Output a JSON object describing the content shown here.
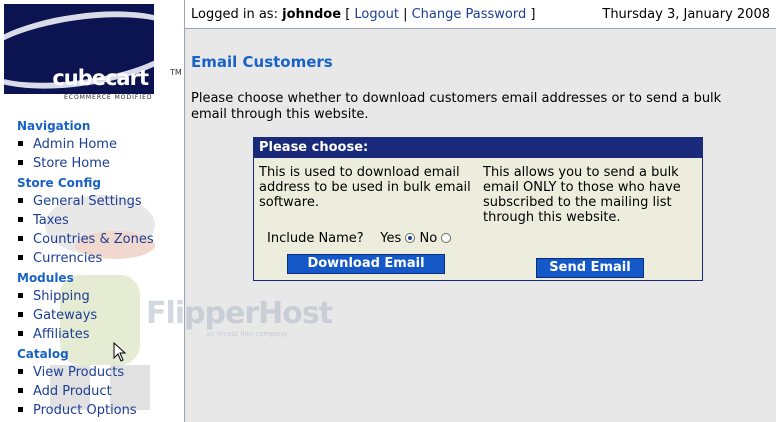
{
  "logo": {
    "wordmark": "cubecart",
    "tm": "TM",
    "subtitle": "ECOMMERCE MODIFIED"
  },
  "header": {
    "logged_in_prefix": "Logged in as:",
    "username": "johndoe",
    "open_bracket": "[",
    "logout": "Logout",
    "separator": "|",
    "change_password": "Change Password",
    "close_bracket": "]",
    "date": "Thursday 3, January 2008"
  },
  "sidebar": {
    "sections": [
      {
        "heading": "Navigation",
        "items": [
          "Admin Home",
          "Store Home"
        ]
      },
      {
        "heading": "Store Config",
        "items": [
          "General Settings",
          "Taxes",
          "Countries & Zones",
          "Currencies"
        ]
      },
      {
        "heading": "Modules",
        "items": [
          "Shipping",
          "Gateways",
          "Affiliates"
        ]
      },
      {
        "heading": "Catalog",
        "items": [
          "View Products",
          "Add Product",
          "Product Options"
        ]
      }
    ]
  },
  "main": {
    "title": "Email Customers",
    "intro": "Please choose whether to download customers email addresses or to send a bulk email through this website.",
    "box": {
      "heading": "Please choose:",
      "download_text": "This is used to download email address to be used in bulk email software.",
      "send_text": "This allows you to send a bulk email ONLY to those who have subscribed to the mailing list through this website.",
      "include_name_label": "Include Name?",
      "yes_label": "Yes",
      "no_label": "No",
      "selected": "Yes",
      "download_button": "Download Email",
      "send_button": "Send Email"
    }
  },
  "watermark": {
    "text": "FlipperHost",
    "sub": "an invest lion company"
  },
  "colors": {
    "accent": "#1a63c6",
    "link": "#1c3f94",
    "box_header": "#1a2a7a",
    "button": "#1559c8",
    "main_bg": "#e8e8e8"
  }
}
